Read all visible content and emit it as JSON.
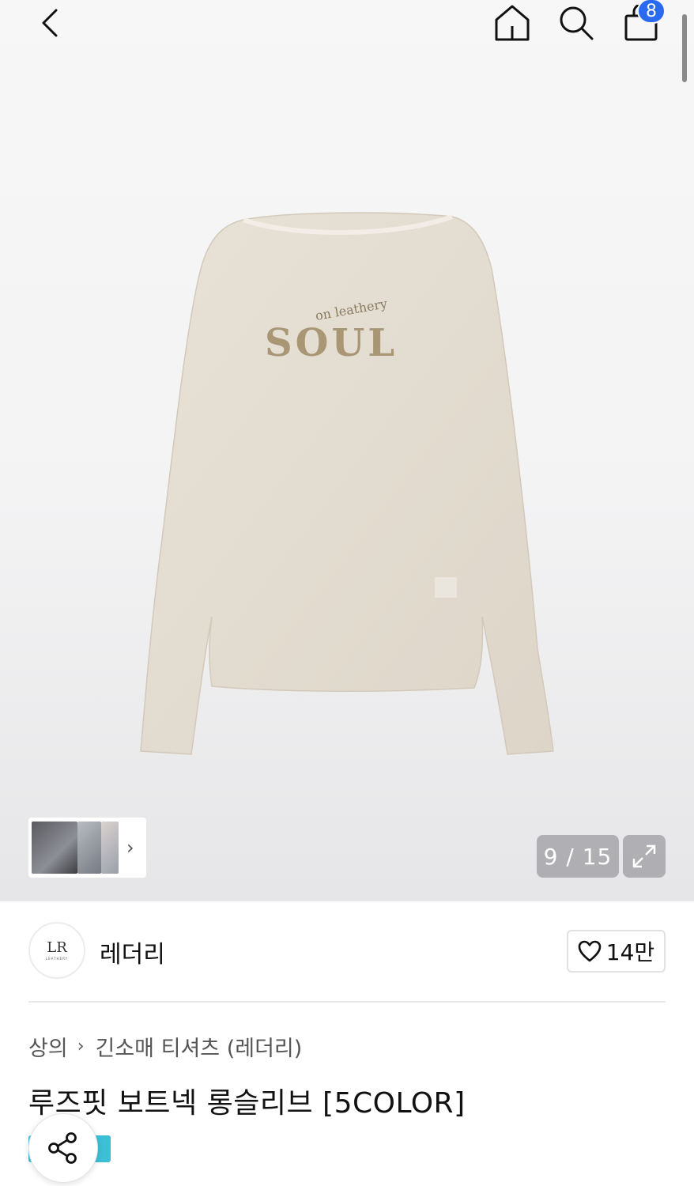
{
  "header": {
    "back_icon": "chevron-left-icon",
    "home_icon": "home-icon",
    "search_icon": "search-icon",
    "cart_icon": "shopping-bag-icon",
    "cart_count": "8"
  },
  "gallery": {
    "counter": "9 / 15",
    "expand_icon": "expand-icon",
    "thumb_arrow": "›",
    "shirt_print_small": "on leathery",
    "shirt_print_large": "SOUL"
  },
  "brand": {
    "name": "레더리",
    "logo_monogram": "LR",
    "logo_text": "LEATHERY",
    "like_count": "14만"
  },
  "breadcrumb": {
    "items": [
      "상의",
      "긴소매 티셔츠 (레더리)"
    ],
    "separator": "›"
  },
  "product": {
    "title": "루즈핏 보트넥 롱슬리브 [5COLOR]"
  },
  "colors": {
    "badge": "#2a6af0",
    "tag": "#3cc0d6",
    "shirt": "#e3dccf"
  }
}
